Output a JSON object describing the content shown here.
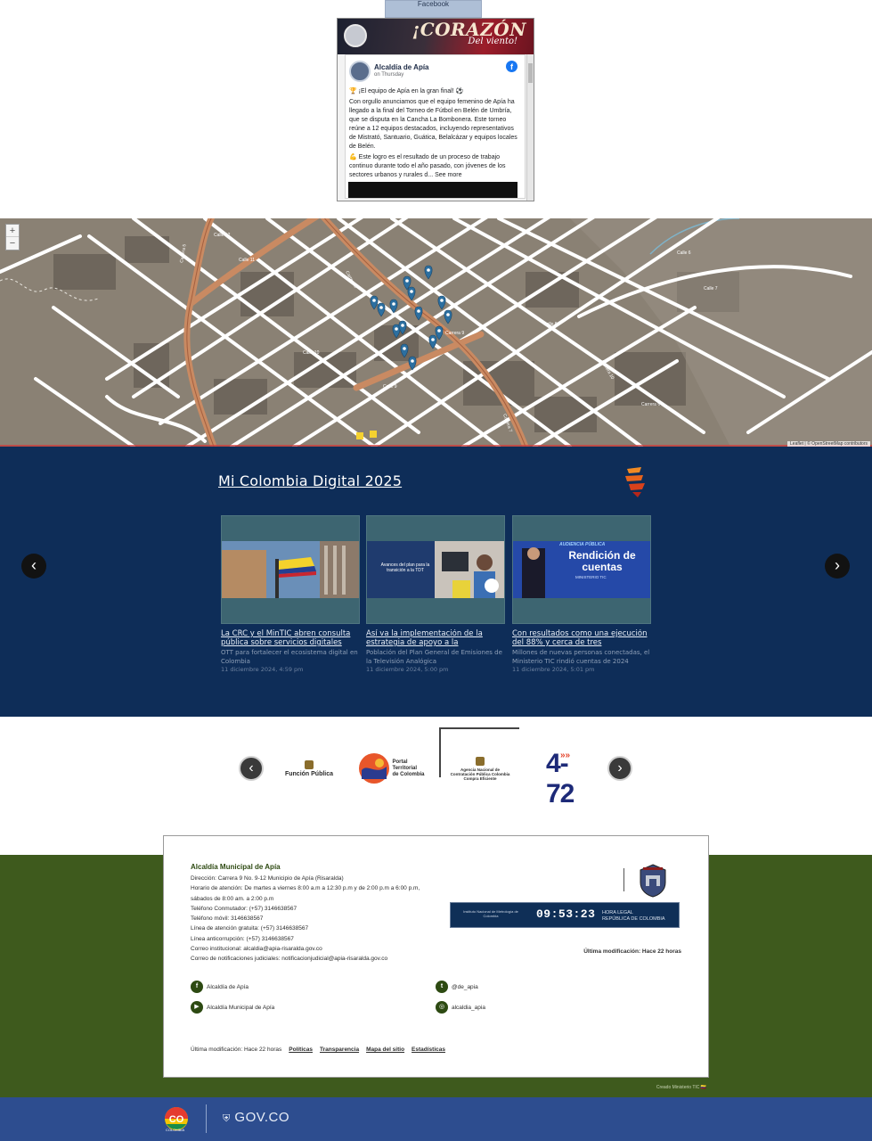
{
  "facebook": {
    "tab_label": "Facebook",
    "cover_title": "¡CORAZÓN",
    "cover_subtitle": "Del viento!",
    "post": {
      "page_name": "Alcaldía de Apía",
      "time": "on Thursday",
      "paragraph1": "🏆 ¡El equipo de Apía en la gran final! ⚽",
      "paragraph2": "Con orgullo anunciamos que el equipo femenino de Apía ha llegado a la final del Torneo de Fútbol en Belén de Umbría, que se disputa en la Cancha La Bombonera. Este torneo reúne a 12 equipos destacados, incluyendo representativos de Mistrató, Santuario, Guática, Belalcázar y equipos locales de Belén.",
      "paragraph3": "💪 Este logro es el resultado de un proceso de trabajo continuo durante todo el año pasado, con jóvenes de los sectores urbanos y rurales d...",
      "see_more": "See more"
    }
  },
  "map": {
    "zoom_in": "+",
    "zoom_out": "−",
    "attribution": "Leaflet | © OpenStreetMap contributors",
    "street_labels": [
      "Calle 11",
      "Carrera 8",
      "Calle 10",
      "Carrera 9",
      "Calle 9",
      "Carrera 7",
      "Calle 8",
      "Carrera 10",
      "Calle 12",
      "Carrera 6",
      "Calle 7",
      "Carrera 5",
      "Calle 6"
    ]
  },
  "mi_colombia": {
    "title": "Mi Colombia Digital 2025",
    "prev_icon": "‹",
    "next_icon": "›",
    "cards": [
      {
        "title": "La CRC y el MinTIC abren consulta pública sobre servicios digitales",
        "description": "OTT para fortalecer el ecosistema digital en Colombia",
        "date": "11 diciembre 2024, 4:59 pm",
        "image_caption": ""
      },
      {
        "title": "Así va la implementación de la estrategia de apoyo a la",
        "description": "Población del Plan General de Emisiones de la Televisión Analógica",
        "date": "11 diciembre 2024, 5:00 pm",
        "image_caption": "Avances del plan para la transición a la TDT"
      },
      {
        "title": "Con resultados como una ejecución del 88% y cerca de tres",
        "description": "Millones de nuevas personas conectadas, el Ministerio TIC rindió cuentas de 2024",
        "date": "11 diciembre 2024, 5:01 pm",
        "image_caption": "AUDIENCIA PÚBLICA",
        "image_headline": "Rendición de cuentas",
        "image_sub": "MINISTERIO TIC"
      }
    ]
  },
  "partners": {
    "prev_icon": "‹",
    "next_icon": "›",
    "logos": [
      {
        "name": "Función Pública"
      },
      {
        "name": "Portal Territorial de Colombia"
      },
      {
        "name": "Agencia Nacional de Contratación Pública Colombia Compra Eficiente"
      },
      {
        "name": "4-72"
      }
    ]
  },
  "footer": {
    "title": "Alcaldía Municipal de Apía",
    "lines": [
      "Dirección: Carrera 9 No. 9-12 Municipio de Apía (Risaralda)",
      "Horario de atención: De martes a viernes 8:00 a.m a 12:30 p.m y de 2:00 p.m a 6:00 p.m,",
      "sábados de 8:00 am. a 2:00 p.m",
      "Teléfono Conmutador: (+57) 3146638567",
      "Teléfono móvil: 3146638567",
      "Línea de atención gratuita: (+57) 3146638567",
      "Línea anticorrupción: (+57) 3146638567",
      "Correo institucional: alcaldia@apia-risaralda.gov.co",
      "Correo de notificaciones judiciales: notificacionjudicial@apia-risaralda.gov.co"
    ],
    "clock": {
      "left_text": "Instituto Nacional de Metrología de Colombia",
      "time": "09:53:23",
      "label_line1": "HORA LEGAL",
      "label_line2": "REPÚBLICA DE COLOMBIA"
    },
    "last_modified_right": "Última modificación: Hace 22 horas",
    "social": [
      {
        "icon": "f",
        "label": "Alcaldía de Apía"
      },
      {
        "icon": "t",
        "label": "@de_apia"
      },
      {
        "icon": "▶",
        "label": "Alcaldía Municipal de Apía"
      },
      {
        "icon": "◎",
        "label": "alcaldia_apia"
      }
    ],
    "bottom": {
      "last_modified": "Última modificación: Hace 22 horas",
      "links": [
        "Políticas",
        "Transparencia",
        "Mapa del sitio",
        "Estadísticas"
      ]
    },
    "credit": "Creado Ministerio TIC 🇨🇴"
  },
  "govbar": {
    "co_text": "CO",
    "co_sub": "COLOMBIA",
    "gov_text": "GOV.CO"
  },
  "colors": {
    "navy": "#0e2d58",
    "footer_green": "#3e5a1d",
    "gov_blue": "#2d4d8f",
    "map_base": "#8a8174",
    "road_main": "#c98a62",
    "road_minor": "#ffffff",
    "marker": "#2c6fa0"
  }
}
